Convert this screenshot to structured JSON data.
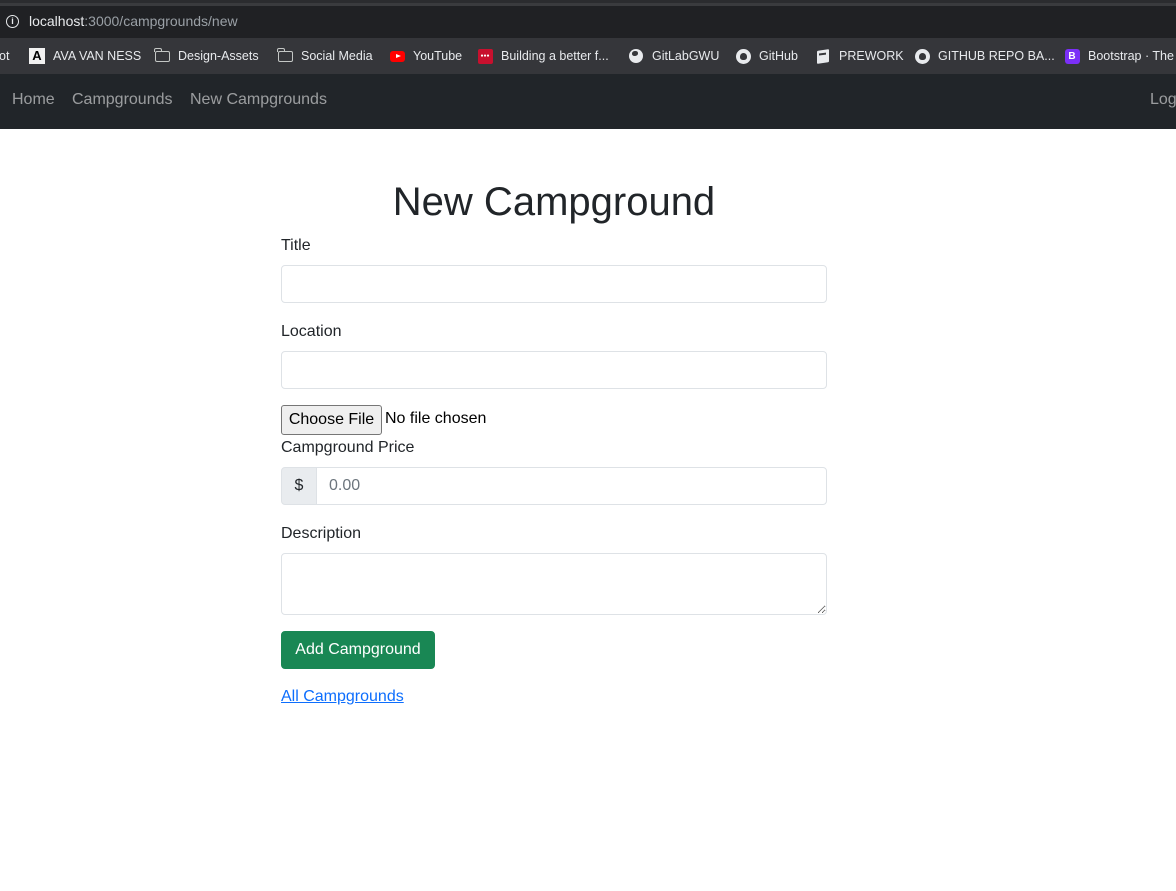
{
  "browser": {
    "url_host": "localhost",
    "url_path": ":3000/campgrounds/new",
    "bookmarks": [
      {
        "label": "ot",
        "icon": "none"
      },
      {
        "label": "AVA VAN NESS",
        "icon": "a-logo-icon"
      },
      {
        "label": "Design-Assets",
        "icon": "folder-icon"
      },
      {
        "label": "Social Media",
        "icon": "folder-icon"
      },
      {
        "label": "YouTube",
        "icon": "youtube-icon"
      },
      {
        "label": "Building a better f...",
        "icon": "red-logo-icon"
      },
      {
        "label": "GitLabGWU",
        "icon": "globe-icon"
      },
      {
        "label": "GitHub",
        "icon": "github-icon"
      },
      {
        "label": "PREWORK",
        "icon": "book-icon"
      },
      {
        "label": "GITHUB REPO BA...",
        "icon": "github-icon"
      },
      {
        "label": "Bootstrap · The",
        "icon": "bootstrap-icon"
      }
    ]
  },
  "navbar": {
    "links": [
      "Home",
      "Campgrounds",
      "New Campgrounds"
    ],
    "right_link": "Log"
  },
  "form": {
    "heading": "New Campground",
    "title_label": "Title",
    "title_value": "",
    "location_label": "Location",
    "location_value": "",
    "file_button": "Choose File",
    "file_status": "No file chosen",
    "price_label": "Campground Price",
    "price_prefix": "$",
    "price_placeholder": "0.00",
    "description_label": "Description",
    "description_value": "",
    "submit_label": "Add Campground",
    "back_link": "All Campgrounds"
  },
  "colors": {
    "navbar_bg": "#212529",
    "submit_bg": "#198754",
    "link": "#0d6efd"
  }
}
